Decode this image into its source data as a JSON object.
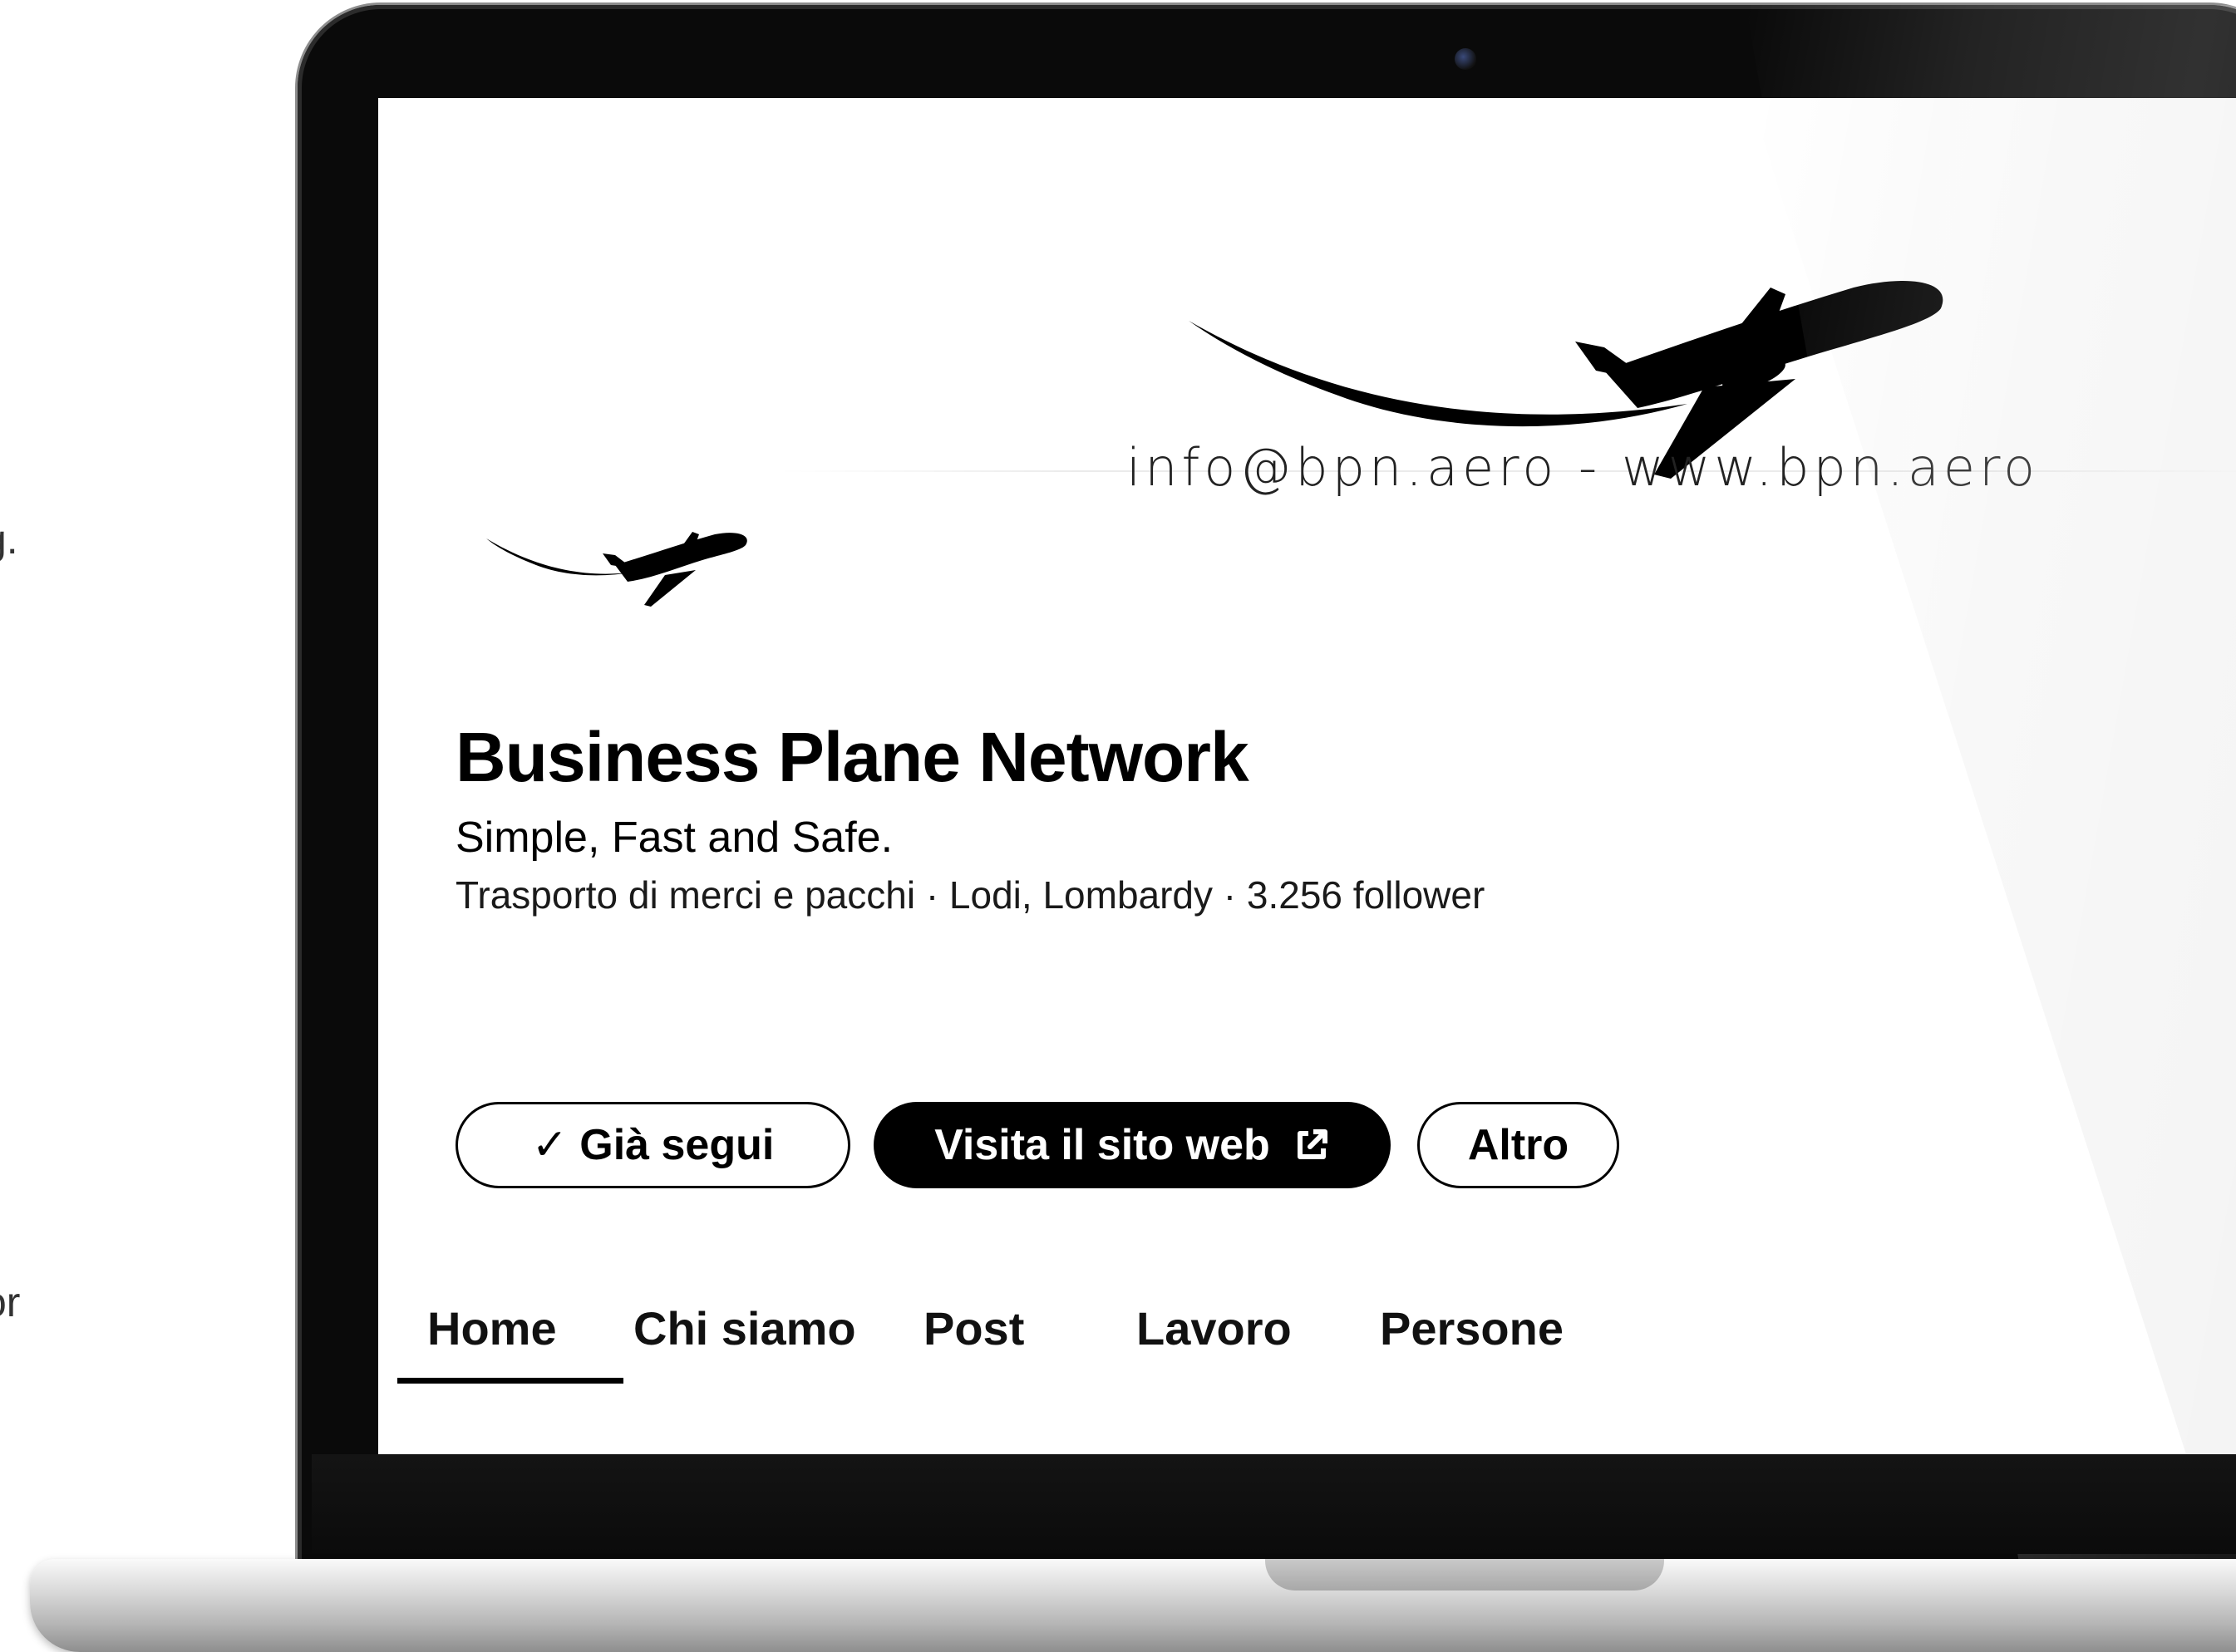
{
  "background_text": {
    "fragment_1": "g.",
    "fragment_2": "or"
  },
  "page": {
    "banner": {
      "contact_line": "info@bpn.aero - www.bpn.aero"
    },
    "company": {
      "name": "Business Plane Network",
      "tagline": "Simple, Fast and Safe.",
      "meta": "Trasporto di merci e pacchi · Lodi, Lombardy · 3.256 follower"
    },
    "actions": {
      "following_check": "✓",
      "following_label": "Già segui",
      "website_label": "Visita il sito web",
      "more_label": "Altro"
    },
    "tabs": [
      {
        "label": "Home",
        "active": true
      },
      {
        "label": "Chi siamo",
        "active": false
      },
      {
        "label": "Post",
        "active": false
      },
      {
        "label": "Lavoro",
        "active": false
      },
      {
        "label": "Persone",
        "active": false
      }
    ]
  },
  "icons": {
    "banner": "airplane-icon",
    "logo": "airplane-logo-icon",
    "external_link": "external-link-icon",
    "check": "checkmark-icon"
  },
  "colors": {
    "primary_button": "#000000",
    "background": "#ffffff",
    "text": "#000000",
    "device_bezel": "#0a0a0a"
  }
}
